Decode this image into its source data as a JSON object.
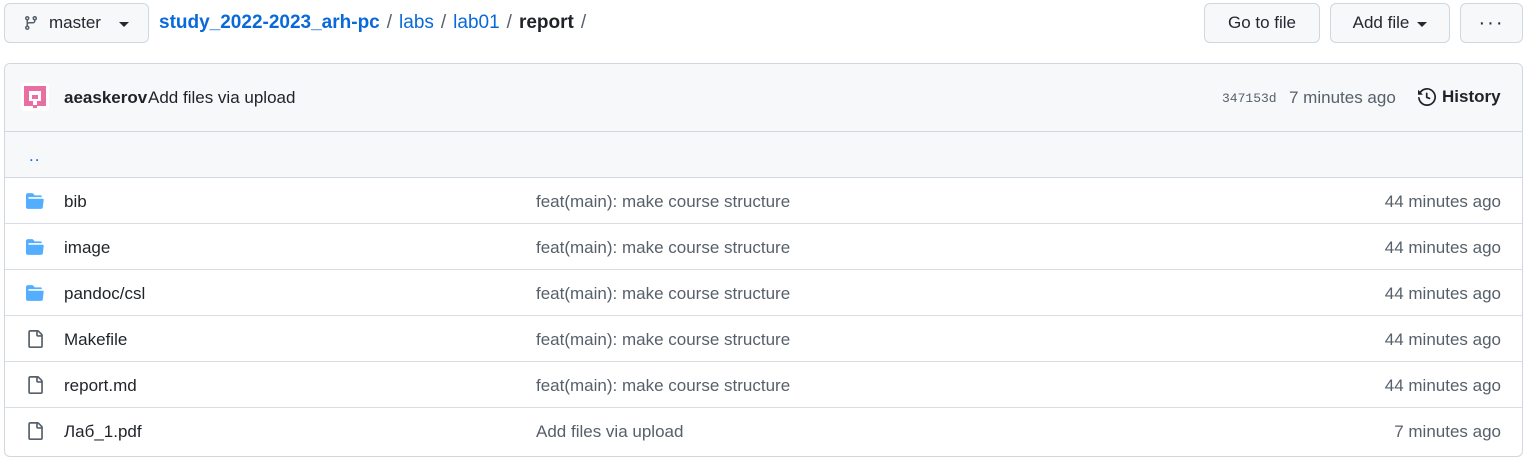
{
  "branch": {
    "name": "master",
    "icon": "git-branch-icon"
  },
  "breadcrumb": {
    "repo": "study_2022-2023_arh-pc",
    "path": [
      "labs",
      "lab01"
    ],
    "current": "report",
    "separator": "/"
  },
  "actions": {
    "goto_file": "Go to file",
    "add_file": "Add file",
    "more": "···"
  },
  "commit": {
    "author": "aeaskerov",
    "message": "Add files via upload",
    "sha": "347153d",
    "time": "7 minutes ago",
    "history_label": "History"
  },
  "updir": "..",
  "files": [
    {
      "type": "dir",
      "icon": "folder-icon",
      "name": "bib",
      "message": "feat(main): make course structure",
      "time": "44 minutes ago"
    },
    {
      "type": "dir",
      "icon": "folder-icon",
      "name": "image",
      "message": "feat(main): make course structure",
      "time": "44 minutes ago"
    },
    {
      "type": "dir",
      "icon": "folder-icon",
      "name": "pandoc/csl",
      "message": "feat(main): make course structure",
      "time": "44 minutes ago"
    },
    {
      "type": "file",
      "icon": "file-icon",
      "name": "Makefile",
      "message": "feat(main): make course structure",
      "time": "44 minutes ago"
    },
    {
      "type": "file",
      "icon": "file-icon",
      "name": "report.md",
      "message": "feat(main): make course structure",
      "time": "44 minutes ago"
    },
    {
      "type": "file",
      "icon": "file-icon",
      "name": "Лаб_1.pdf",
      "message": "Add files via upload",
      "time": "7 minutes ago"
    }
  ],
  "colors": {
    "link": "#0969da",
    "folder": "#54aeff",
    "avatar": "#e86ea4",
    "muted": "#57606a",
    "border": "#d0d7de"
  }
}
